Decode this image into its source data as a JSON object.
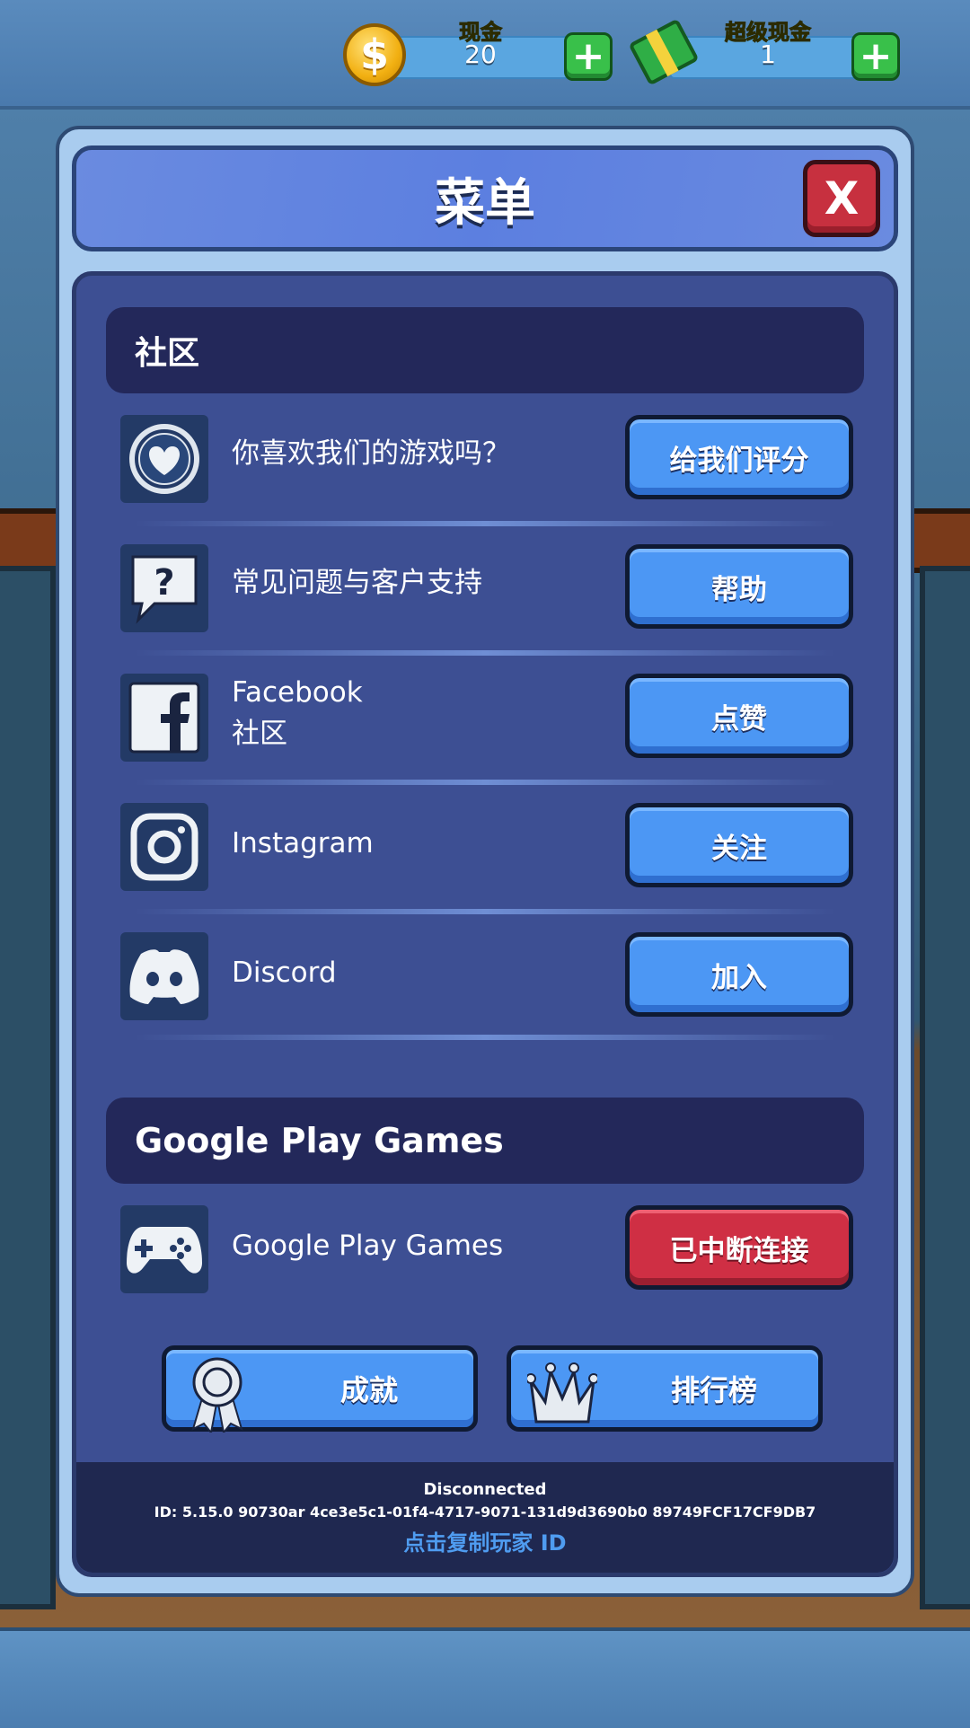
{
  "currency": {
    "cash": {
      "label": "现金",
      "value": "20",
      "label_color": "#f4ea45"
    },
    "super_cash": {
      "label": "超级现金",
      "value": "1",
      "label_color": "#6ff06a"
    }
  },
  "menu": {
    "title": "菜单",
    "close_label": "X"
  },
  "community": {
    "heading": "社区",
    "rows": [
      {
        "icon": "heart-icon",
        "text": "你喜欢我们的游戏吗？",
        "button": "给我们评分"
      },
      {
        "icon": "question-bubble-icon",
        "text": "常见问题与客户支持",
        "button": "帮助"
      },
      {
        "icon": "facebook-icon",
        "text_line1": "Facebook",
        "text_line2": "社区",
        "button": "点赞"
      },
      {
        "icon": "instagram-icon",
        "text": "Instagram",
        "button": "关注"
      },
      {
        "icon": "discord-icon",
        "text": "Discord",
        "button": "加入"
      }
    ]
  },
  "google_play": {
    "heading": "Google Play Games",
    "row": {
      "icon": "gamepad-icon",
      "text": "Google Play Games",
      "button": "已中断连接"
    },
    "achievements_label": "成就",
    "leaderboard_label": "排行榜"
  },
  "footer": {
    "status": "Disconnected",
    "player_id": "ID: 5.15.0 90730ar 4ce3e5c1-01f4-4717-9071-131d9d3690b0 89749FCF17CF9DB7",
    "copy_link": "点击复制玩家 ID"
  },
  "colors": {
    "button_blue": "#4c97f4",
    "button_red": "#cf2f44",
    "panel_dark": "#3d4f93",
    "section_head": "#23285a",
    "copy_link": "#4f9cf0"
  }
}
